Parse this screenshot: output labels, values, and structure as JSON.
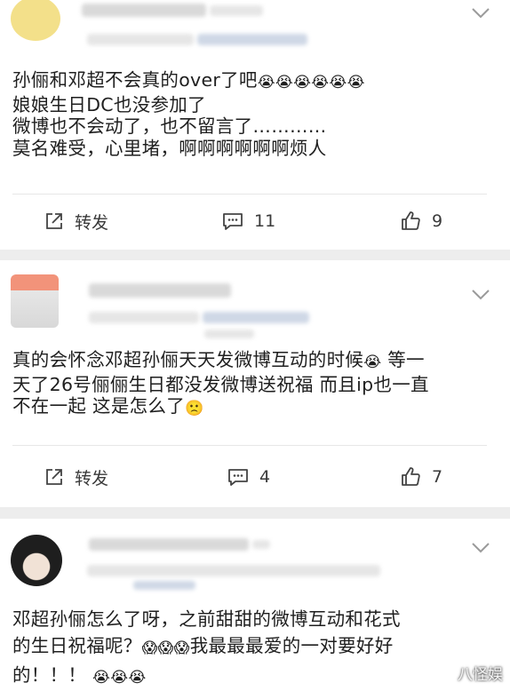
{
  "comments": [
    {
      "lines": [
        "孙俪和邓超不会真的over了吧",
        "娘娘生日DC也没参加了",
        "微博也不会动了，也不留言了…………",
        "莫名难受，心里堵，啊啊啊啊啊啊烦人"
      ],
      "emojis_line1": [
        "😭",
        "😭",
        "😭",
        "😭",
        "😭",
        "😭"
      ],
      "actions": {
        "repost": "转发",
        "comments": "11",
        "likes": "9"
      }
    },
    {
      "lines": [
        "真的会怀念邓超孙俪天天发微博互动的时候",
        "天了26号俪俪生日都没发微博送祝福 而且ip也一直",
        "不在一起 这是怎么了"
      ],
      "line1_emoji": "😭",
      "line1_tail": " 等一",
      "line3_emoji": "🙁",
      "actions": {
        "repost": "转发",
        "comments": "4",
        "likes": "7"
      }
    },
    {
      "lines": [
        "邓超孙俪怎么了呀，之前甜甜的微博互动和花式",
        "的生日祝福呢？",
        "我最最最爱的一对要好好",
        "的！！！"
      ],
      "line2_emojis": [
        "😱",
        "😱",
        "😱"
      ],
      "line3_emojis": [
        "😭",
        "😭",
        "😭"
      ]
    }
  ],
  "watermark": "八怪娱",
  "icons": {
    "repost": "share-square-icon",
    "comment": "comment-bubble-icon",
    "like": "thumb-up-icon",
    "more": "chevron-down-icon"
  }
}
